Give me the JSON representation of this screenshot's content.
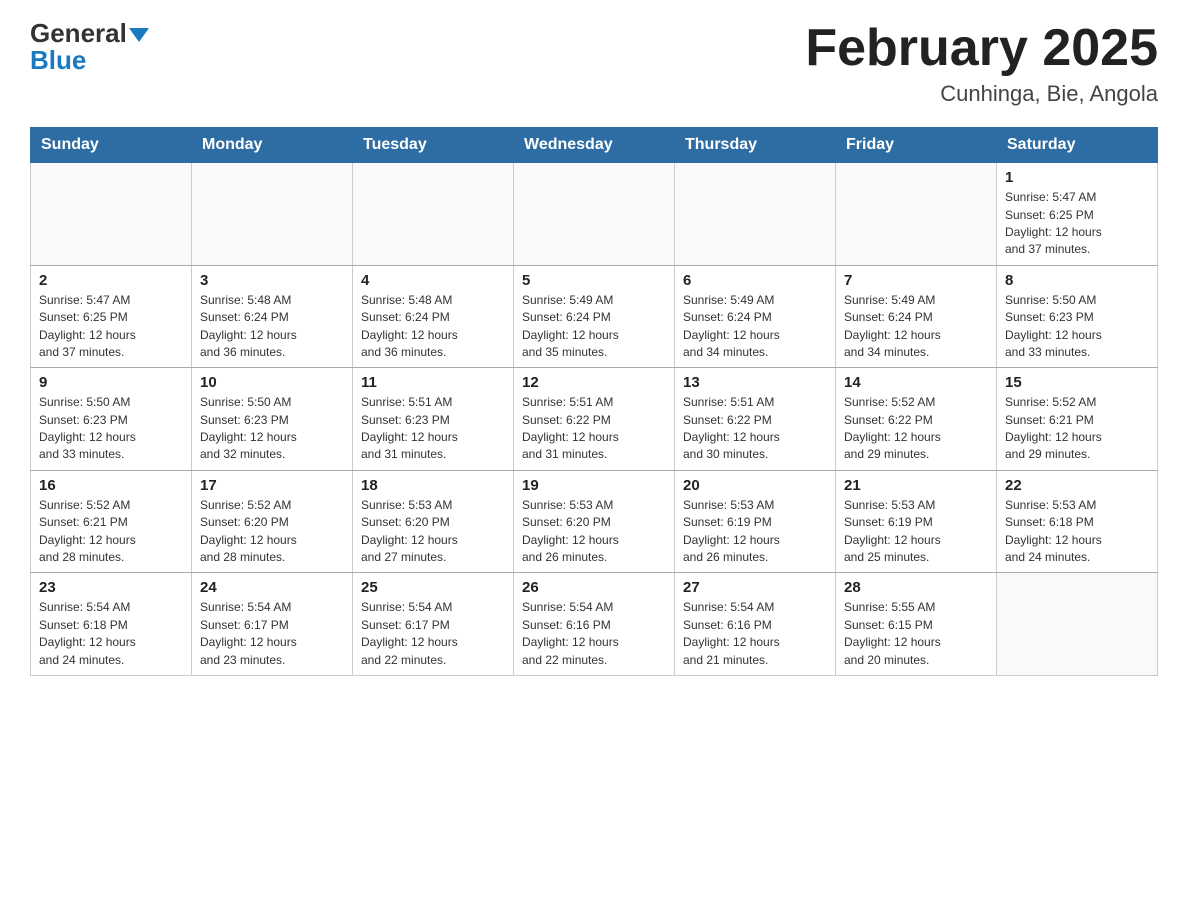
{
  "header": {
    "logo_general": "General",
    "logo_blue": "Blue",
    "month_title": "February 2025",
    "location": "Cunhinga, Bie, Angola"
  },
  "weekdays": [
    "Sunday",
    "Monday",
    "Tuesday",
    "Wednesday",
    "Thursday",
    "Friday",
    "Saturday"
  ],
  "weeks": [
    [
      {
        "day": "",
        "info": ""
      },
      {
        "day": "",
        "info": ""
      },
      {
        "day": "",
        "info": ""
      },
      {
        "day": "",
        "info": ""
      },
      {
        "day": "",
        "info": ""
      },
      {
        "day": "",
        "info": ""
      },
      {
        "day": "1",
        "info": "Sunrise: 5:47 AM\nSunset: 6:25 PM\nDaylight: 12 hours\nand 37 minutes."
      }
    ],
    [
      {
        "day": "2",
        "info": "Sunrise: 5:47 AM\nSunset: 6:25 PM\nDaylight: 12 hours\nand 37 minutes."
      },
      {
        "day": "3",
        "info": "Sunrise: 5:48 AM\nSunset: 6:24 PM\nDaylight: 12 hours\nand 36 minutes."
      },
      {
        "day": "4",
        "info": "Sunrise: 5:48 AM\nSunset: 6:24 PM\nDaylight: 12 hours\nand 36 minutes."
      },
      {
        "day": "5",
        "info": "Sunrise: 5:49 AM\nSunset: 6:24 PM\nDaylight: 12 hours\nand 35 minutes."
      },
      {
        "day": "6",
        "info": "Sunrise: 5:49 AM\nSunset: 6:24 PM\nDaylight: 12 hours\nand 34 minutes."
      },
      {
        "day": "7",
        "info": "Sunrise: 5:49 AM\nSunset: 6:24 PM\nDaylight: 12 hours\nand 34 minutes."
      },
      {
        "day": "8",
        "info": "Sunrise: 5:50 AM\nSunset: 6:23 PM\nDaylight: 12 hours\nand 33 minutes."
      }
    ],
    [
      {
        "day": "9",
        "info": "Sunrise: 5:50 AM\nSunset: 6:23 PM\nDaylight: 12 hours\nand 33 minutes."
      },
      {
        "day": "10",
        "info": "Sunrise: 5:50 AM\nSunset: 6:23 PM\nDaylight: 12 hours\nand 32 minutes."
      },
      {
        "day": "11",
        "info": "Sunrise: 5:51 AM\nSunset: 6:23 PM\nDaylight: 12 hours\nand 31 minutes."
      },
      {
        "day": "12",
        "info": "Sunrise: 5:51 AM\nSunset: 6:22 PM\nDaylight: 12 hours\nand 31 minutes."
      },
      {
        "day": "13",
        "info": "Sunrise: 5:51 AM\nSunset: 6:22 PM\nDaylight: 12 hours\nand 30 minutes."
      },
      {
        "day": "14",
        "info": "Sunrise: 5:52 AM\nSunset: 6:22 PM\nDaylight: 12 hours\nand 29 minutes."
      },
      {
        "day": "15",
        "info": "Sunrise: 5:52 AM\nSunset: 6:21 PM\nDaylight: 12 hours\nand 29 minutes."
      }
    ],
    [
      {
        "day": "16",
        "info": "Sunrise: 5:52 AM\nSunset: 6:21 PM\nDaylight: 12 hours\nand 28 minutes."
      },
      {
        "day": "17",
        "info": "Sunrise: 5:52 AM\nSunset: 6:20 PM\nDaylight: 12 hours\nand 28 minutes."
      },
      {
        "day": "18",
        "info": "Sunrise: 5:53 AM\nSunset: 6:20 PM\nDaylight: 12 hours\nand 27 minutes."
      },
      {
        "day": "19",
        "info": "Sunrise: 5:53 AM\nSunset: 6:20 PM\nDaylight: 12 hours\nand 26 minutes."
      },
      {
        "day": "20",
        "info": "Sunrise: 5:53 AM\nSunset: 6:19 PM\nDaylight: 12 hours\nand 26 minutes."
      },
      {
        "day": "21",
        "info": "Sunrise: 5:53 AM\nSunset: 6:19 PM\nDaylight: 12 hours\nand 25 minutes."
      },
      {
        "day": "22",
        "info": "Sunrise: 5:53 AM\nSunset: 6:18 PM\nDaylight: 12 hours\nand 24 minutes."
      }
    ],
    [
      {
        "day": "23",
        "info": "Sunrise: 5:54 AM\nSunset: 6:18 PM\nDaylight: 12 hours\nand 24 minutes."
      },
      {
        "day": "24",
        "info": "Sunrise: 5:54 AM\nSunset: 6:17 PM\nDaylight: 12 hours\nand 23 minutes."
      },
      {
        "day": "25",
        "info": "Sunrise: 5:54 AM\nSunset: 6:17 PM\nDaylight: 12 hours\nand 22 minutes."
      },
      {
        "day": "26",
        "info": "Sunrise: 5:54 AM\nSunset: 6:16 PM\nDaylight: 12 hours\nand 22 minutes."
      },
      {
        "day": "27",
        "info": "Sunrise: 5:54 AM\nSunset: 6:16 PM\nDaylight: 12 hours\nand 21 minutes."
      },
      {
        "day": "28",
        "info": "Sunrise: 5:55 AM\nSunset: 6:15 PM\nDaylight: 12 hours\nand 20 minutes."
      },
      {
        "day": "",
        "info": ""
      }
    ]
  ]
}
